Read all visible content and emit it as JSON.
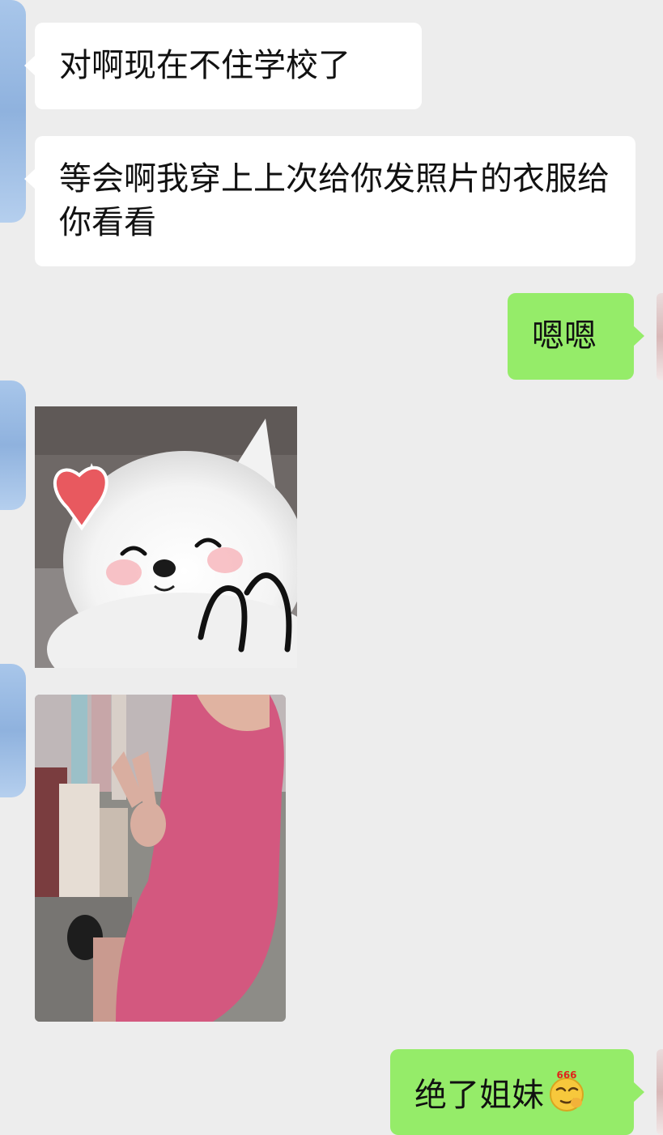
{
  "messages": [
    {
      "side": "received",
      "type": "text",
      "text": "对啊现在不住学校了"
    },
    {
      "side": "received",
      "type": "text",
      "text": "等会啊我穿上上次给你发照片的衣服给你看看"
    },
    {
      "side": "sent",
      "type": "text",
      "text": "嗯嗯"
    },
    {
      "side": "received",
      "type": "sticker",
      "description": "white-dog-heart-sticker"
    },
    {
      "side": "received",
      "type": "photo",
      "description": "pink-dress-photo"
    },
    {
      "side": "sent",
      "type": "text",
      "text": "绝了姐妹",
      "emoji": "smirk-666-emoji",
      "emoji_badge": "666"
    }
  ],
  "colors": {
    "background": "#ededed",
    "received_bubble": "#ffffff",
    "sent_bubble": "#95ec69",
    "text": "#111111"
  }
}
